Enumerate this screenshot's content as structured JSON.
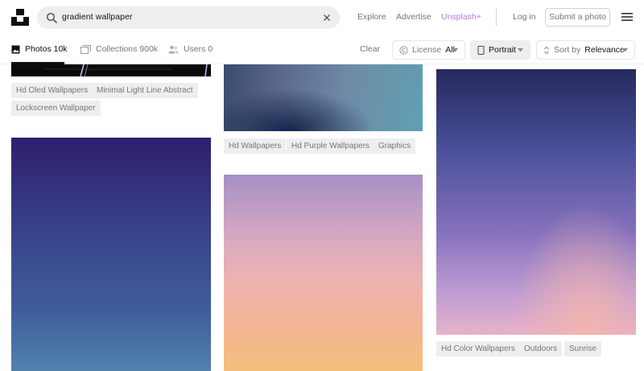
{
  "search": {
    "query": "gradient wallpaper"
  },
  "nav": {
    "explore": "Explore",
    "advertise": "Advertise",
    "unsplash_plus": "Unsplash+",
    "login": "Log in",
    "submit": "Submit a photo"
  },
  "tabs": {
    "photos": "Photos 10k",
    "collections": "Collections 900k",
    "users": "Users 0"
  },
  "filters": {
    "clear": "Clear",
    "license_prefix": "License",
    "license_value": "All",
    "orientation": "Portrait",
    "sort_prefix": "Sort by",
    "sort_value": "Relevance"
  },
  "photos": {
    "col1_top_tags": [
      "Hd Oled Wallpapers",
      "Minimal Light Line Abstract",
      "Lockscreen Wallpaper"
    ],
    "col2_top_tags": [
      "Hd Wallpapers",
      "Hd Purple Wallpapers",
      "Graphics"
    ],
    "col3_tags": [
      "Hd Color Wallpapers",
      "Outdoors",
      "Sunrise"
    ]
  },
  "colors": {
    "accent_plus": "#b478e0",
    "text_muted": "#767676",
    "tag_bg": "#eeeeee"
  }
}
